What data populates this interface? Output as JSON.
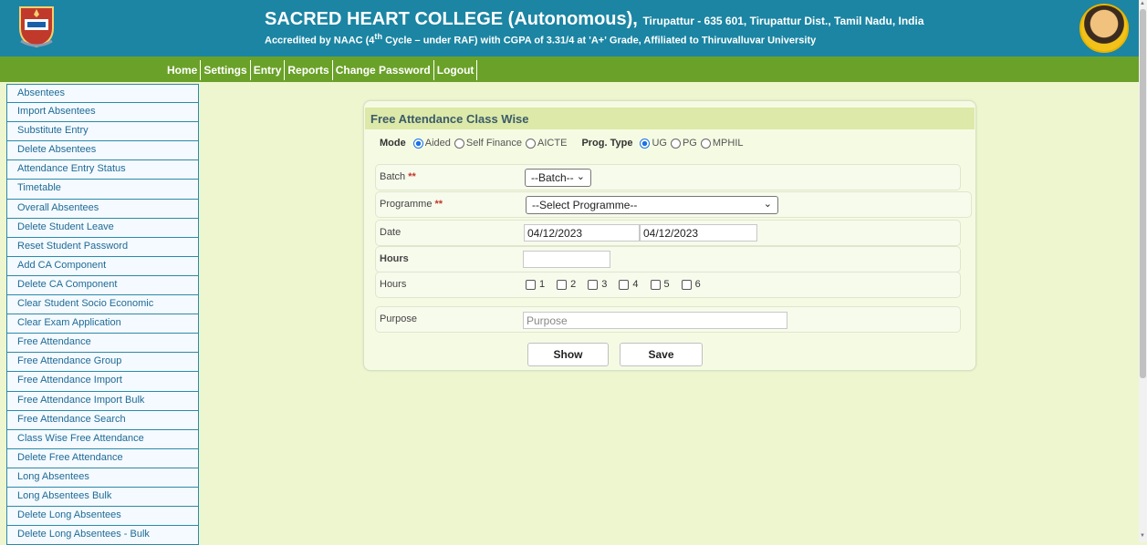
{
  "header": {
    "college_name": "SACRED HEART COLLEGE (Autonomous),",
    "location": "Tirupattur - 635 601, Tirupattur Dist., Tamil Nadu, India",
    "accreditation_pre": "Accredited by NAAC (4",
    "accreditation_sup": "th",
    "accreditation_post": " Cycle – under RAF) with CGPA of 3.31/4 at 'A+' Grade, Affiliated to Thiruvalluvar University"
  },
  "menu": [
    "Home",
    "Settings",
    "Entry",
    "Reports",
    "Change Password",
    "Logout"
  ],
  "sidebar": [
    "Absentees",
    "Import Absentees",
    "Substitute Entry",
    "Delete Absentees",
    "Attendance Entry Status",
    "Timetable",
    "Overall Absentees",
    "Delete Student Leave",
    "Reset Student Password",
    "Add CA Component",
    "Delete CA Component",
    "Clear Student Socio Economic",
    "Clear Exam Application",
    "Free Attendance",
    "Free Attendance Group",
    "Free Attendance Import",
    "Free Attendance Import Bulk",
    "Free Attendance Search",
    "Class Wise Free Attendance",
    "Delete Free Attendance",
    "Long Absentees",
    "Long Absentees Bulk",
    "Delete Long Absentees",
    "Delete Long Absentees - Bulk"
  ],
  "form": {
    "title": "Free Attendance Class Wise",
    "mode_label": "Mode",
    "mode_options": [
      "Aided",
      "Self Finance",
      "AICTE"
    ],
    "mode_selected": "Aided",
    "prog_type_label": "Prog. Type",
    "prog_type_options": [
      "UG",
      "PG",
      "MPHIL"
    ],
    "prog_type_selected": "UG",
    "batch_label": "Batch",
    "batch_value": "--Batch--",
    "programme_label": "Programme",
    "programme_value": "--Select Programme--",
    "required_mark": "**",
    "date_label": "Date",
    "date_from": "04/12/2023",
    "date_to": "04/12/2023",
    "hours_label": "Hours",
    "hours_value": "",
    "hours_check_label": "Hours",
    "hour_options": [
      "1",
      "2",
      "3",
      "4",
      "5",
      "6"
    ],
    "purpose_label": "Purpose",
    "purpose_placeholder": "Purpose",
    "show_button": "Show",
    "save_button": "Save"
  }
}
